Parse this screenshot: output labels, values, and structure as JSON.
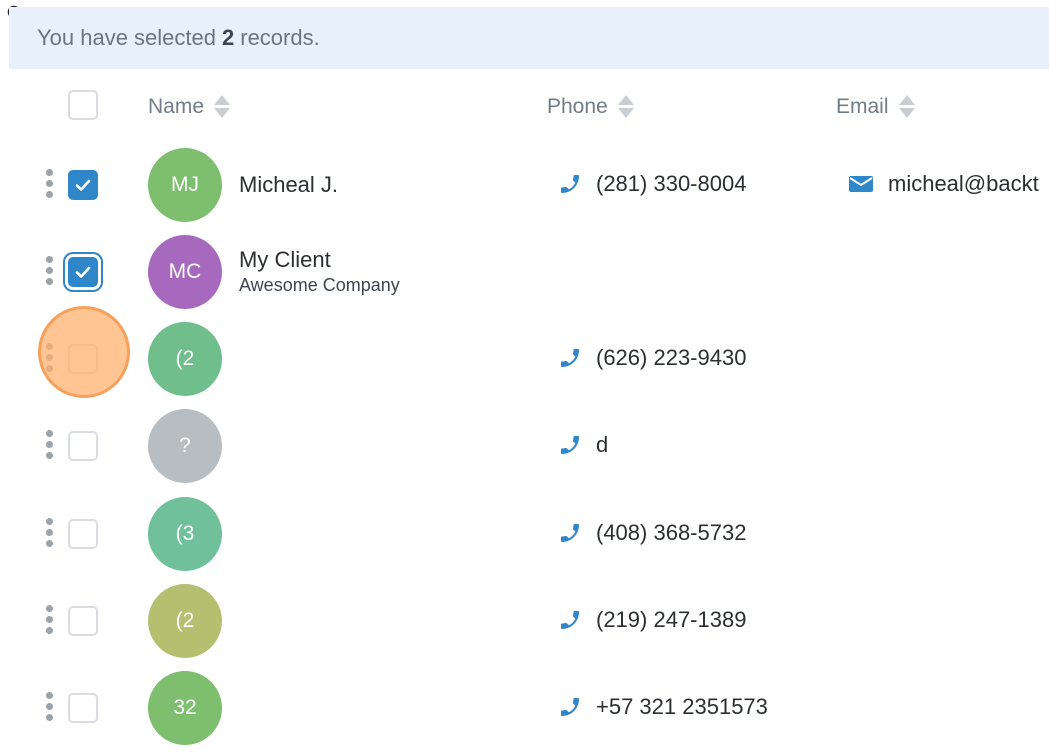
{
  "banner": {
    "prefix": "You have selected",
    "count": "2",
    "suffix": "records."
  },
  "columns": {
    "name": "Name",
    "phone": "Phone",
    "email": "Email"
  },
  "colors": {
    "checkbox_checked": "#2f86c8",
    "phone_icon": "#2f86c8",
    "highlight": "#f6a05c"
  },
  "rows": [
    {
      "checked": true,
      "initials": "MJ",
      "avatar_color": "#7dbe6f",
      "name": "Micheal J.",
      "subtitle": "",
      "phone": "(281) 330-8004",
      "email": "micheal@backt"
    },
    {
      "checked": true,
      "initials": "MC",
      "avatar_color": "#a769be",
      "name": "My Client",
      "subtitle": "Awesome Company",
      "phone": "",
      "email": ""
    },
    {
      "checked": false,
      "initials": "(2",
      "avatar_color": "#6fbe8b",
      "name": "",
      "subtitle": "",
      "phone": "(626) 223-9430",
      "email": ""
    },
    {
      "checked": false,
      "initials": "?",
      "avatar_color": "#b8bdc1",
      "name": "",
      "subtitle": "",
      "phone": "d",
      "email": ""
    },
    {
      "checked": false,
      "initials": "(3",
      "avatar_color": "#70c09c",
      "name": "",
      "subtitle": "",
      "phone": "(408) 368-5732",
      "email": ""
    },
    {
      "checked": false,
      "initials": "(2",
      "avatar_color": "#b4bf6f",
      "name": "",
      "subtitle": "",
      "phone": "(219) 247-1389",
      "email": ""
    },
    {
      "checked": false,
      "initials": "32",
      "avatar_color": "#7dbe6f",
      "name": "",
      "subtitle": "",
      "phone": "+57 321 2351573",
      "email": ""
    }
  ]
}
